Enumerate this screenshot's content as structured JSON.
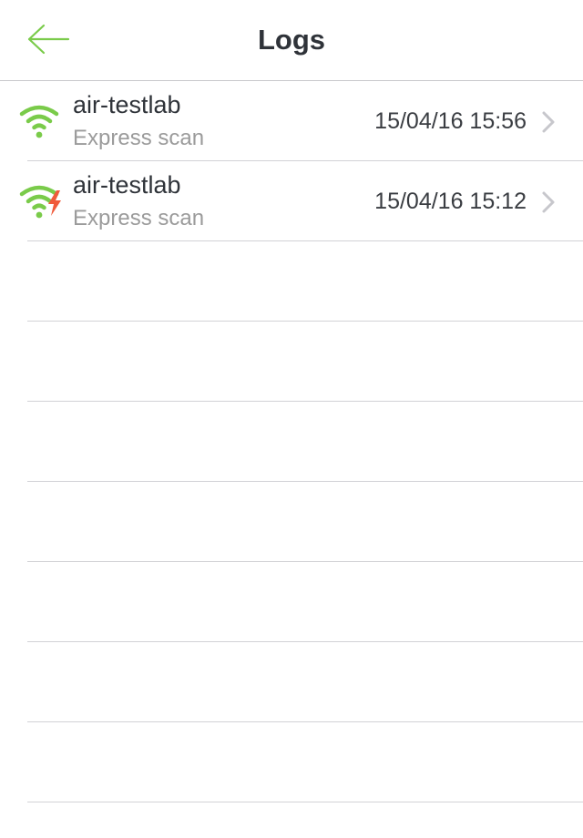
{
  "header": {
    "title": "Logs",
    "back_icon": "arrow-left-icon"
  },
  "logs": [
    {
      "network": "air-testlab",
      "scan_type": "Express scan",
      "datetime": "15/04/16 15:56",
      "icon": "wifi-icon",
      "warning": false
    },
    {
      "network": "air-testlab",
      "scan_type": "Express scan",
      "datetime": "15/04/16 15:12",
      "icon": "wifi-warning-icon",
      "warning": true
    }
  ],
  "colors": {
    "accent": "#7acb4a",
    "warning": "#f05a3a",
    "title_text": "#2f3339",
    "secondary_text": "#9b9b9b",
    "chevron": "#c7c7cc"
  }
}
